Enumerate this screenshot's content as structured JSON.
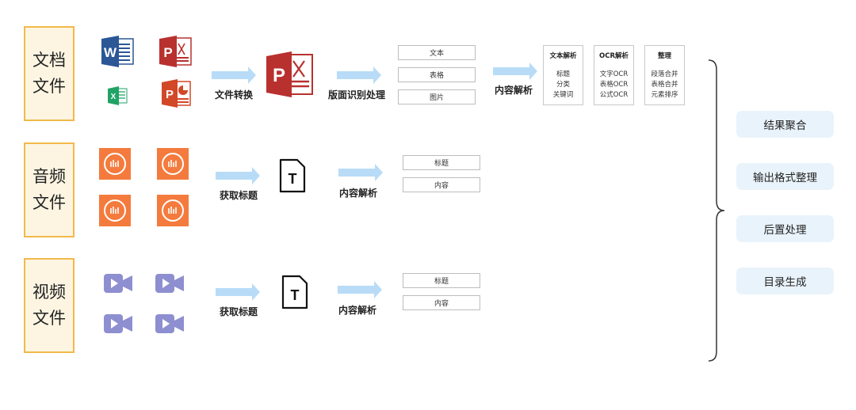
{
  "categories": {
    "doc": "文档\n文件",
    "audio": "音频\n文件",
    "video": "视频\n文件"
  },
  "doc_icons": {
    "word_letter": "W",
    "pdf_letter": "P",
    "excel_letter": "X",
    "ppt_letter": "P",
    "big_pdf_letter": "P"
  },
  "doc_row": {
    "convert_label": "文件转换",
    "layout_label": "版面识别处理",
    "chips": [
      "文本",
      "表格",
      "图片"
    ],
    "parse_label": "内容解析",
    "cards": [
      {
        "title": "文本解析",
        "items": [
          "标题",
          "分类",
          "关键词"
        ]
      },
      {
        "title": "OCR解析",
        "items": [
          "文字OCR",
          "表格OCR",
          "公式OCR"
        ]
      },
      {
        "title": "整理",
        "items": [
          "段落合并",
          "表格合并",
          "元素排序"
        ]
      }
    ]
  },
  "audio_row": {
    "title_label": "获取标题",
    "t_letter": "T",
    "parse_label": "内容解析",
    "chips": [
      "标题",
      "内容"
    ]
  },
  "video_row": {
    "title_label": "获取标题",
    "t_letter": "T",
    "parse_label": "内容解析",
    "chips": [
      "标题",
      "内容"
    ]
  },
  "final_steps": [
    "结果聚合",
    "输出格式整理",
    "后置处理",
    "目录生成"
  ],
  "colors": {
    "category_border": "#f2b94a",
    "category_fill": "#fdf5e2",
    "arrow": "#b8dcf7",
    "pill": "#e9f3fb",
    "word": "#2b5797",
    "pdf": "#b8312f",
    "excel": "#21a366",
    "ppt": "#d24726",
    "audio": "#f47b3d",
    "video": "#8e8fd0"
  }
}
